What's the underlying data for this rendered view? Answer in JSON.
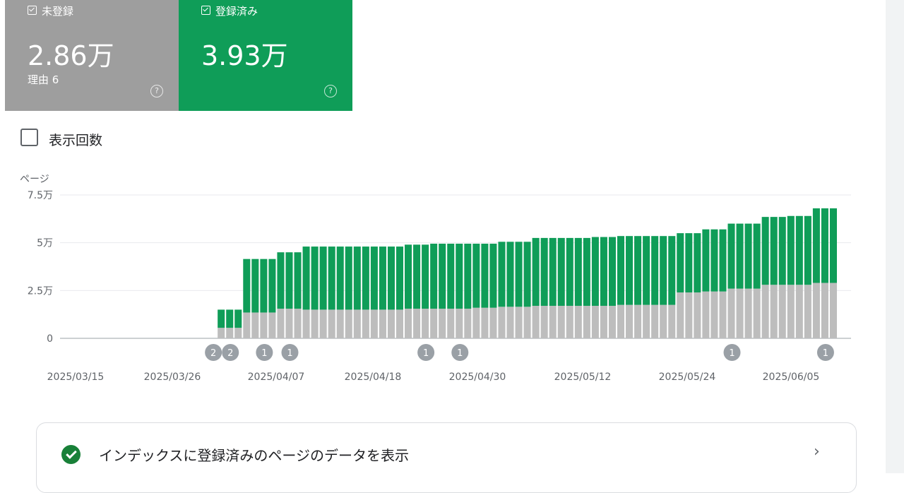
{
  "cards": [
    {
      "title": "未登録",
      "value": "2.86万",
      "sub": "理由 6",
      "color": "#9e9e9e",
      "checked": true
    },
    {
      "title": "登録済み",
      "value": "3.93万",
      "sub": "",
      "color": "#0f9d58",
      "checked": true
    }
  ],
  "help_glyph": "?",
  "impressions_checkbox": {
    "label": "表示回数",
    "checked": false
  },
  "chart_data": {
    "type": "bar",
    "stacked": true,
    "ylabel": "ページ",
    "yticks": [
      "0",
      "2.5万",
      "5万",
      "7.5万"
    ],
    "ylim": [
      0,
      75000
    ],
    "xticks": [
      "2025/03/15",
      "2025/03/26",
      "2025/04/07",
      "2025/04/18",
      "2025/04/30",
      "2025/05/12",
      "2025/05/24",
      "2025/06/05"
    ],
    "categories_count": 90,
    "series": [
      {
        "name": "未登録",
        "color": "#bdbdbd",
        "values": [
          0,
          0,
          0,
          0,
          0,
          0,
          0,
          0,
          0,
          0,
          0,
          0,
          0,
          0,
          0,
          0,
          0,
          5500,
          5500,
          5500,
          13500,
          13500,
          13500,
          13500,
          15500,
          15500,
          15500,
          15000,
          15000,
          15000,
          15000,
          15000,
          15000,
          15000,
          15000,
          15000,
          15000,
          15000,
          15000,
          15500,
          15500,
          15500,
          15500,
          15500,
          15500,
          15500,
          15500,
          16000,
          16000,
          16000,
          16500,
          16500,
          16500,
          16500,
          17000,
          17000,
          17000,
          17000,
          17000,
          17000,
          17000,
          17000,
          17000,
          17000,
          17500,
          17500,
          17500,
          17500,
          17500,
          17500,
          17500,
          24000,
          24000,
          24000,
          24500,
          24500,
          24500,
          26000,
          26000,
          26000,
          26000,
          28000,
          28000,
          28000,
          28000,
          28000,
          28000,
          29000,
          29000,
          29000
        ]
      },
      {
        "name": "登録済み",
        "color": "#0f9d58",
        "values": [
          0,
          0,
          0,
          0,
          0,
          0,
          0,
          0,
          0,
          0,
          0,
          0,
          0,
          0,
          0,
          0,
          0,
          9500,
          9500,
          9500,
          28000,
          28000,
          28000,
          28000,
          29500,
          29500,
          29500,
          33000,
          33000,
          33000,
          33000,
          33000,
          33000,
          33000,
          33000,
          33000,
          33000,
          33000,
          33000,
          33500,
          33500,
          33500,
          34000,
          34000,
          34000,
          34000,
          34000,
          33500,
          33500,
          33500,
          34000,
          34000,
          34000,
          34000,
          35500,
          35500,
          35500,
          35500,
          35500,
          35500,
          35500,
          36000,
          36000,
          36000,
          36000,
          36000,
          36000,
          36000,
          36000,
          36000,
          36000,
          31000,
          31000,
          31000,
          32500,
          32500,
          32500,
          34000,
          34000,
          34000,
          34000,
          35500,
          35500,
          35500,
          36000,
          36000,
          36000,
          39000,
          39000,
          39000
        ]
      }
    ],
    "annotations": [
      {
        "index": 16,
        "label": "2"
      },
      {
        "index": 18,
        "label": "2"
      },
      {
        "index": 22,
        "label": "1"
      },
      {
        "index": 25,
        "label": "1"
      },
      {
        "index": 41,
        "label": "1"
      },
      {
        "index": 45,
        "label": "1"
      },
      {
        "index": 77,
        "label": "1"
      },
      {
        "index": 88,
        "label": "1"
      }
    ]
  },
  "footer": {
    "text": "インデックスに登録済みのページのデータを表示",
    "chevron": "›"
  }
}
